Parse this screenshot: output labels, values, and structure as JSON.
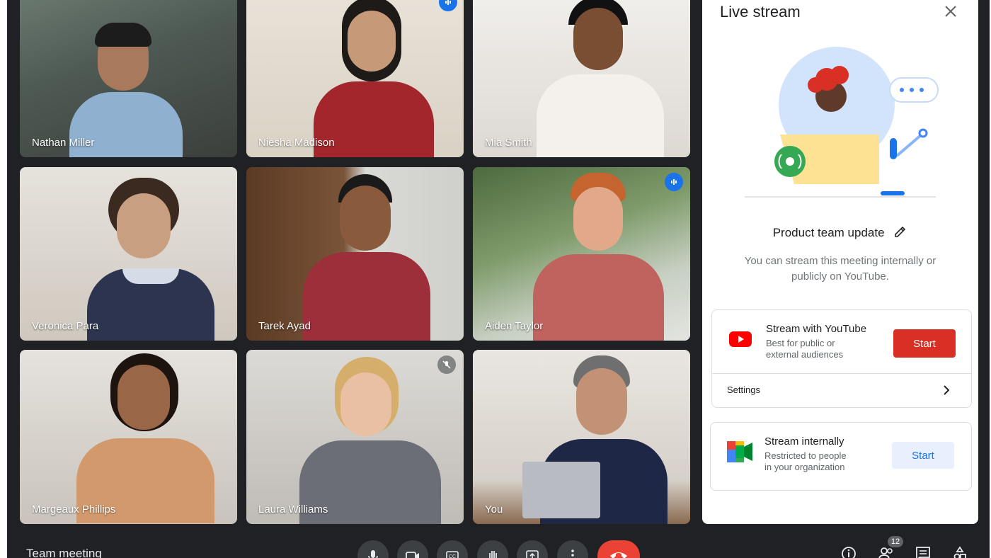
{
  "participants": [
    {
      "name": "Nathan Miller"
    },
    {
      "name": "Niesha Madison"
    },
    {
      "name": "Mia Smith"
    },
    {
      "name": "Veronica Para"
    },
    {
      "name": "Tarek Ayad"
    },
    {
      "name": "Aiden Taylor"
    },
    {
      "name": "Margeaux Phillips"
    },
    {
      "name": "Laura Williams"
    },
    {
      "name": "You"
    }
  ],
  "panel": {
    "title": "Live stream",
    "meeting_name": "Product team update",
    "description": "You can stream this meeting internally or publicly on YouTube.",
    "youtube": {
      "title": "Stream with YouTube",
      "subtitle_line1": "Best for public or",
      "subtitle_line2": "external audiences",
      "start_label": "Start",
      "settings_label": "Settings"
    },
    "internal": {
      "title": "Stream internally",
      "subtitle_line1": "Restricted to people",
      "subtitle_line2": "in your organization",
      "start_label": "Start"
    }
  },
  "bottom_bar": {
    "meeting_title": "Team meeting",
    "participant_count": "12"
  },
  "icons": [
    "close-icon",
    "edit-icon",
    "youtube-icon",
    "meet-icon",
    "chevron-right-icon",
    "mic-icon",
    "camera-icon",
    "captions-icon",
    "raise-hand-icon",
    "present-icon",
    "more-options-icon",
    "end-call-icon",
    "info-icon",
    "people-icon",
    "chat-icon",
    "activities-icon",
    "speaking-icon",
    "mic-off-icon"
  ],
  "colors": {
    "background": "#202124",
    "accent": "#1a73e8",
    "end_call": "#ea4335",
    "youtube_red": "#d93025"
  }
}
